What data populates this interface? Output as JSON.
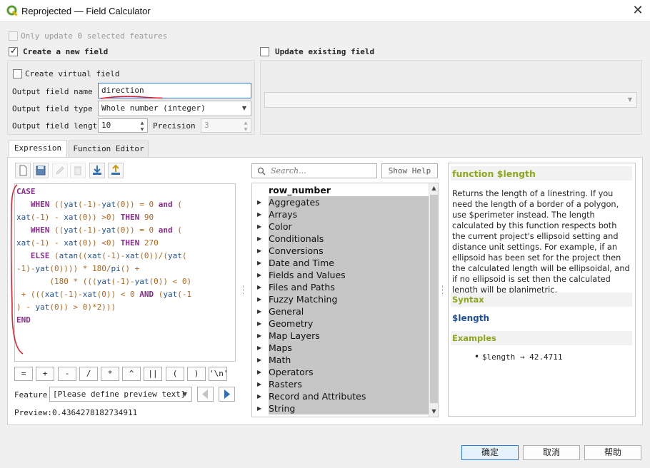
{
  "window": {
    "title": "Reprojected — Field Calculator",
    "close_glyph": "✕"
  },
  "only_update": {
    "label": "Only update 0 selected features",
    "checked": false,
    "enabled": false
  },
  "create_field": {
    "label": "Create a new field",
    "checked": true,
    "virtual_label": "Create virtual field",
    "virtual_checked": false,
    "name_label": "Output field name",
    "name_value": "direction",
    "type_label": "Output field type",
    "type_value": "Whole number (integer)",
    "length_label": "Output field length",
    "length_value": "10",
    "precision_label": "Precision",
    "precision_value": "3"
  },
  "update_field": {
    "label": "Update existing field",
    "checked": false,
    "selected": ""
  },
  "tabs": [
    {
      "label": "Expression",
      "active": true
    },
    {
      "label": "Function Editor",
      "active": false
    }
  ],
  "toolbar_icons": [
    "new-file-icon",
    "save-icon",
    "edit-icon",
    "delete-icon",
    "import-icon",
    "export-icon"
  ],
  "expression": {
    "lines": [
      [
        [
          "kw",
          "CASE"
        ]
      ],
      [
        [
          "sp",
          "   "
        ],
        [
          "kw",
          "WHEN"
        ],
        [
          "t",
          " (("
        ],
        [
          "fn",
          "yat"
        ],
        [
          "t",
          "(-1)-"
        ],
        [
          "fn",
          "yat"
        ],
        [
          "t",
          "(0)) = 0 "
        ],
        [
          "kw",
          "and"
        ],
        [
          "t",
          " ("
        ]
      ],
      [
        [
          "fn",
          "xat"
        ],
        [
          "t",
          "(-1) - "
        ],
        [
          "fn",
          "xat"
        ],
        [
          "t",
          "(0)) >0) "
        ],
        [
          "kw",
          "THEN"
        ],
        [
          "t",
          " 90"
        ]
      ],
      [
        [
          "sp",
          "   "
        ],
        [
          "kw",
          "WHEN"
        ],
        [
          "t",
          " (("
        ],
        [
          "fn",
          "yat"
        ],
        [
          "t",
          "(-1)-"
        ],
        [
          "fn",
          "yat"
        ],
        [
          "t",
          "(0)) = 0 "
        ],
        [
          "kw",
          "and"
        ],
        [
          "t",
          " ("
        ]
      ],
      [
        [
          "fn",
          "xat"
        ],
        [
          "t",
          "(-1) - "
        ],
        [
          "fn",
          "xat"
        ],
        [
          "t",
          "(0)) <0) "
        ],
        [
          "kw",
          "THEN"
        ],
        [
          "t",
          " 270"
        ]
      ],
      [
        [
          "sp",
          "   "
        ],
        [
          "kw",
          "ELSE"
        ],
        [
          "t",
          " ("
        ],
        [
          "fn",
          "atan"
        ],
        [
          "t",
          "(("
        ],
        [
          "fn",
          "xat"
        ],
        [
          "t",
          "(-1)-"
        ],
        [
          "fn",
          "xat"
        ],
        [
          "t",
          "(0))/("
        ],
        [
          "fn",
          "yat"
        ],
        [
          "t",
          "("
        ]
      ],
      [
        [
          "t",
          "-1)-"
        ],
        [
          "fn",
          "yat"
        ],
        [
          "t",
          "(0)))) * 180/"
        ],
        [
          "fn",
          "pi"
        ],
        [
          "t",
          "() +"
        ]
      ],
      [
        [
          "sp",
          "       "
        ],
        [
          "t",
          "(180 * ((("
        ],
        [
          "fn",
          "yat"
        ],
        [
          "t",
          "(-1)-"
        ],
        [
          "fn",
          "yat"
        ],
        [
          "t",
          "(0)) < 0)"
        ]
      ],
      [
        [
          "t",
          " + ((("
        ],
        [
          "fn",
          "xat"
        ],
        [
          "t",
          "(-1)-"
        ],
        [
          "fn",
          "xat"
        ],
        [
          "t",
          "(0)) < 0 "
        ],
        [
          "kw",
          "AND"
        ],
        [
          "t",
          " ("
        ],
        [
          "fn",
          "yat"
        ],
        [
          "t",
          "(-1"
        ]
      ],
      [
        [
          "t",
          ") - "
        ],
        [
          "fn",
          "yat"
        ],
        [
          "t",
          "(0)) > 0)*2)))"
        ]
      ],
      [
        [
          "kw",
          "END"
        ]
      ]
    ]
  },
  "operators": [
    "=",
    "+",
    "-",
    "/",
    "*",
    "^",
    "||",
    "(",
    ")",
    "'\\n'"
  ],
  "feature": {
    "label": "Feature",
    "value": "[Please define preview text]"
  },
  "preview": {
    "label": "Preview:",
    "value": "0.4364278182734911"
  },
  "search": {
    "placeholder": "Search..."
  },
  "show_help_label": "Show Help",
  "function_list": [
    {
      "label": "row_number",
      "group": false
    },
    {
      "label": "Aggregates",
      "group": true
    },
    {
      "label": "Arrays",
      "group": true
    },
    {
      "label": "Color",
      "group": true
    },
    {
      "label": "Conditionals",
      "group": true
    },
    {
      "label": "Conversions",
      "group": true
    },
    {
      "label": "Date and Time",
      "group": true
    },
    {
      "label": "Fields and Values",
      "group": true
    },
    {
      "label": "Files and Paths",
      "group": true
    },
    {
      "label": "Fuzzy Matching",
      "group": true
    },
    {
      "label": "General",
      "group": true
    },
    {
      "label": "Geometry",
      "group": true
    },
    {
      "label": "Map Layers",
      "group": true
    },
    {
      "label": "Maps",
      "group": true
    },
    {
      "label": "Math",
      "group": true
    },
    {
      "label": "Operators",
      "group": true
    },
    {
      "label": "Rasters",
      "group": true
    },
    {
      "label": "Record and Attributes",
      "group": true
    },
    {
      "label": "String",
      "group": true
    }
  ],
  "help": {
    "title": "function $length",
    "description": "Returns the length of a linestring. If you need the length of a border of a polygon, use $perimeter instead. The length calculated by this function respects both the current project's ellipsoid setting and distance unit settings. For example, if an ellipsoid has been set for the project then the calculated length will be ellipsoidal, and if no ellipsoid is set then the calculated length will be planimetric.",
    "syntax_header": "Syntax",
    "syntax": "$length",
    "examples_header": "Examples",
    "example": "$length → 42.4711"
  },
  "buttons": {
    "ok": "确定",
    "cancel": "取消",
    "help": "帮助"
  },
  "colors": {
    "accent": "#2b7ad6",
    "keyword": "#8a2c8e",
    "function": "#1f4f9c",
    "number": "#b5651d",
    "help_header": "#8ba81f",
    "annotation": "#e0202a"
  }
}
